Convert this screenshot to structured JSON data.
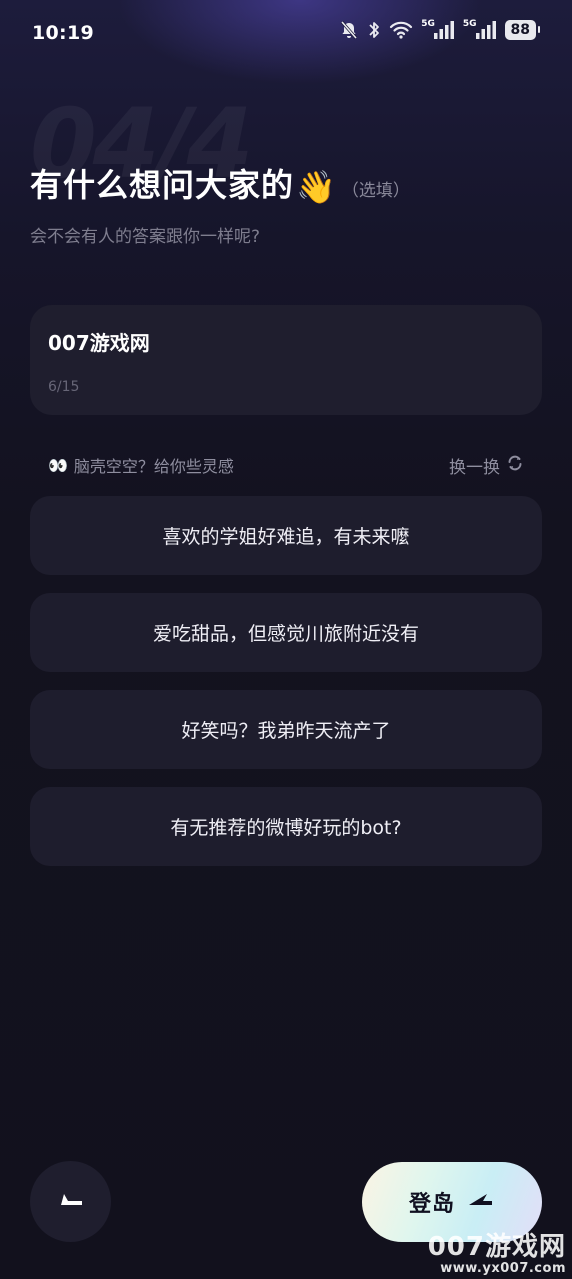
{
  "status_bar": {
    "time": "10:19",
    "sig1_label": "5G",
    "sig2_label": "5G",
    "battery": "88"
  },
  "step": {
    "indicator": "04/4"
  },
  "header": {
    "title": "有什么想问大家的",
    "emoji": "👋",
    "optional": "（选填）",
    "subtitle": "会不会有人的答案跟你一样呢?"
  },
  "question": {
    "value": "007游戏网",
    "count": "6/15"
  },
  "inspiration": {
    "emoji": "👀",
    "label": "脑壳空空？给你些灵感",
    "refresh_label": "换一换"
  },
  "suggestions": [
    "喜欢的学姐好难追，有未来嚒",
    "爱吃甜品，但感觉川旅附近没有",
    "好笑吗？我弟昨天流产了",
    "有无推荐的微博好玩的bot?"
  ],
  "footer": {
    "enter_label": "登岛"
  },
  "watermark": {
    "main": "007游戏网",
    "url": "www.yx007.com"
  },
  "colors": {
    "background": "#13121f",
    "card": "#1f1e2e",
    "muted_text": "#7e7d8e"
  }
}
